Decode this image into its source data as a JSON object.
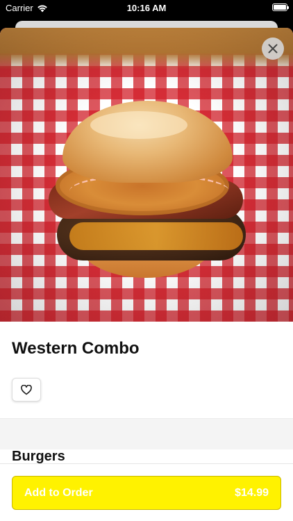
{
  "status_bar": {
    "carrier": "Carrier",
    "time": "10:16 AM",
    "wifi_icon": "wifi-icon",
    "battery_icon": "battery-full-icon"
  },
  "hero": {
    "image_description_icon": "burger-photo",
    "close_icon": "close-icon"
  },
  "item": {
    "name": "Western Combo",
    "favorite_icon": "heart-outline-icon",
    "category": "Burgers"
  },
  "order": {
    "button_label": "Add to Order",
    "price": "$14.99",
    "button_color": "#fff200"
  }
}
